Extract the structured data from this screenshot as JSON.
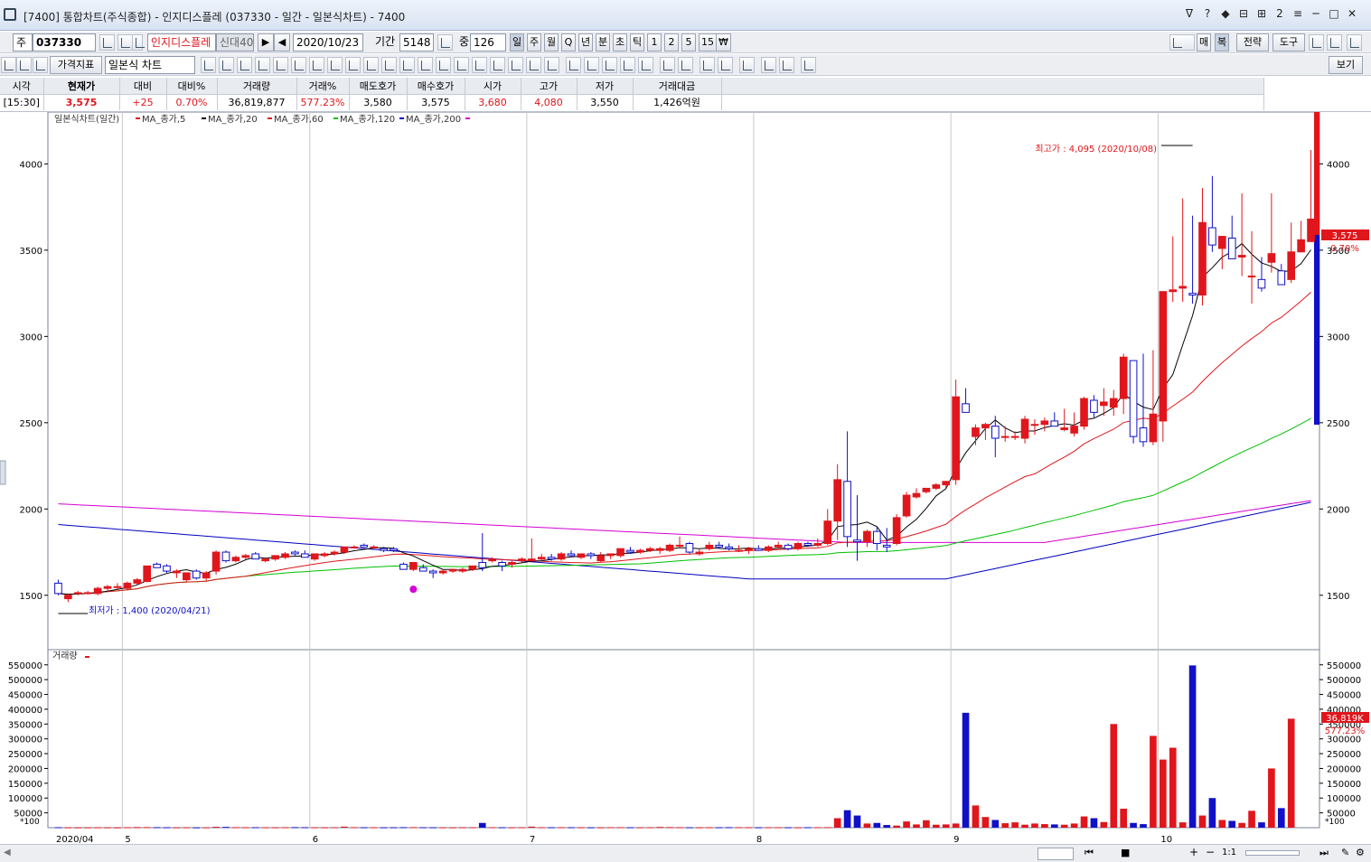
{
  "window": {
    "title": "[7400]  통합차트(주식종합)  - 인지디스플레 (037330 - 일간 - 일본식차트)  - 7400",
    "controls": [
      "ᐁ",
      "?",
      "◆",
      "⊟",
      "⊞",
      "2",
      "≡",
      "─",
      "□",
      "✕"
    ]
  },
  "toolbar1": {
    "market": "주",
    "code": "037330",
    "name": "인지디스플레",
    "credit": "신대40",
    "date": "2020/10/23",
    "period_label": "기간",
    "period": "5148",
    "mid_label": "중",
    "count": "126",
    "periods": [
      "일",
      "주",
      "월",
      "Q",
      "년",
      "분",
      "초",
      "틱",
      "1",
      "2",
      "5",
      "15",
      "₩"
    ],
    "right_buttons": [
      "매",
      "복",
      "전략",
      "도구"
    ]
  },
  "toolbar2": {
    "indicator": "가격지표",
    "chart_type": "일본식 차트",
    "view": "보기"
  },
  "quote": {
    "headers": [
      "시각",
      "현재가",
      "대비",
      "대비%",
      "거래량",
      "거래%",
      "매도호가",
      "매수호가",
      "시가",
      "고가",
      "저가",
      "거래대금"
    ],
    "values": [
      "[15:30]",
      "3,575",
      "+25",
      "0.70%",
      "36,819,877",
      "577.23%",
      "3,580",
      "3,575",
      "3,680",
      "4,080",
      "3,550",
      "1,426억원"
    ]
  },
  "chart_data": {
    "type": "candlestick",
    "title": "일본식차트(일간)",
    "legend": [
      "MA_종가,5",
      "MA_종가,20",
      "MA_종가,60",
      "MA_종가,120",
      "MA_종가,200"
    ],
    "ma_colors": [
      "#e0161c",
      "#000000",
      "#e0161c",
      "#00c000",
      "#0000c0",
      "#d400d4"
    ],
    "price_axis": {
      "ticks": [
        1500,
        2000,
        2500,
        3000,
        3500,
        4000
      ],
      "ylim": [
        1190,
        4290
      ]
    },
    "volume_label": "거래량",
    "volume_axis": {
      "ticks": [
        50000,
        100000,
        150000,
        200000,
        250000,
        300000,
        350000,
        400000,
        450000,
        500000,
        550000
      ],
      "ylim": [
        0,
        592000
      ],
      "unit": "*100"
    },
    "x_labels": [
      "2020/04",
      "5",
      "6",
      "7",
      "8",
      "9",
      "10"
    ],
    "x_label_index": [
      0,
      7,
      26,
      48,
      71,
      91,
      112
    ],
    "current_price_tag": "3,575",
    "current_pct_tag": "0.70%",
    "volume_tag": "36,819K",
    "volume_pct_tag": "577.23%",
    "high_note": "최고가 : 4,095 (2020/10/08)",
    "low_note": "최저가 : 1,400 (2020/04/21)",
    "candles": [
      [
        1570,
        1590,
        1500,
        1510
      ],
      [
        1480,
        1510,
        1460,
        1500
      ],
      [
        1510,
        1525,
        1500,
        1515
      ],
      [
        1515,
        1525,
        1505,
        1515
      ],
      [
        1510,
        1550,
        1500,
        1540
      ],
      [
        1540,
        1560,
        1520,
        1550
      ],
      [
        1550,
        1570,
        1530,
        1550
      ],
      [
        1540,
        1580,
        1530,
        1570
      ],
      [
        1570,
        1600,
        1560,
        1590
      ],
      [
        1580,
        1670,
        1575,
        1670
      ],
      [
        1680,
        1690,
        1660,
        1660
      ],
      [
        1670,
        1680,
        1630,
        1640
      ],
      [
        1630,
        1650,
        1600,
        1640
      ],
      [
        1590,
        1630,
        1580,
        1630
      ],
      [
        1640,
        1650,
        1590,
        1600
      ],
      [
        1600,
        1640,
        1580,
        1630
      ],
      [
        1640,
        1760,
        1620,
        1750
      ],
      [
        1750,
        1760,
        1690,
        1700
      ],
      [
        1700,
        1730,
        1690,
        1720
      ],
      [
        1720,
        1740,
        1710,
        1730
      ],
      [
        1740,
        1750,
        1710,
        1710
      ],
      [
        1700,
        1720,
        1690,
        1710
      ],
      [
        1710,
        1730,
        1700,
        1730
      ],
      [
        1720,
        1750,
        1710,
        1740
      ],
      [
        1750,
        1760,
        1730,
        1740
      ],
      [
        1740,
        1760,
        1720,
        1720
      ],
      [
        1710,
        1730,
        1700,
        1740
      ],
      [
        1730,
        1750,
        1720,
        1740
      ],
      [
        1740,
        1760,
        1730,
        1750
      ],
      [
        1750,
        1780,
        1740,
        1780
      ],
      [
        1780,
        1790,
        1770,
        1780
      ],
      [
        1790,
        1800,
        1780,
        1780
      ],
      [
        1780,
        1790,
        1770,
        1780
      ],
      [
        1770,
        1780,
        1750,
        1760
      ],
      [
        1770,
        1780,
        1750,
        1760
      ],
      [
        1680,
        1690,
        1650,
        1650
      ],
      [
        1650,
        1690,
        1640,
        1690
      ],
      [
        1660,
        1680,
        1640,
        1640
      ],
      [
        1640,
        1650,
        1600,
        1630
      ],
      [
        1630,
        1650,
        1620,
        1640
      ],
      [
        1640,
        1650,
        1630,
        1650
      ],
      [
        1640,
        1660,
        1630,
        1650
      ],
      [
        1650,
        1670,
        1640,
        1670
      ],
      [
        1690,
        1860,
        1640,
        1660
      ],
      [
        1700,
        1720,
        1690,
        1710
      ],
      [
        1690,
        1700,
        1640,
        1670
      ],
      [
        1680,
        1700,
        1660,
        1690
      ],
      [
        1700,
        1720,
        1690,
        1710
      ],
      [
        1700,
        1830,
        1700,
        1710
      ],
      [
        1710,
        1740,
        1700,
        1720
      ],
      [
        1720,
        1740,
        1700,
        1710
      ],
      [
        1710,
        1750,
        1700,
        1740
      ],
      [
        1740,
        1760,
        1720,
        1730
      ],
      [
        1720,
        1740,
        1710,
        1740
      ],
      [
        1740,
        1750,
        1710,
        1730
      ],
      [
        1700,
        1750,
        1690,
        1730
      ],
      [
        1730,
        1740,
        1710,
        1740
      ],
      [
        1730,
        1770,
        1720,
        1770
      ],
      [
        1760,
        1780,
        1740,
        1750
      ],
      [
        1750,
        1770,
        1740,
        1760
      ],
      [
        1760,
        1780,
        1750,
        1770
      ],
      [
        1760,
        1780,
        1740,
        1770
      ],
      [
        1760,
        1800,
        1750,
        1790
      ],
      [
        1790,
        1840,
        1770,
        1790
      ],
      [
        1800,
        1810,
        1740,
        1750
      ],
      [
        1740,
        1770,
        1730,
        1750
      ],
      [
        1770,
        1810,
        1760,
        1790
      ],
      [
        1790,
        1810,
        1770,
        1780
      ],
      [
        1780,
        1800,
        1760,
        1770
      ],
      [
        1760,
        1790,
        1750,
        1760
      ],
      [
        1760,
        1780,
        1740,
        1770
      ],
      [
        1770,
        1790,
        1760,
        1760
      ],
      [
        1760,
        1790,
        1750,
        1780
      ],
      [
        1780,
        1810,
        1770,
        1790
      ],
      [
        1790,
        1800,
        1760,
        1770
      ],
      [
        1770,
        1810,
        1760,
        1800
      ],
      [
        1800,
        1810,
        1780,
        1790
      ],
      [
        1790,
        1830,
        1780,
        1800
      ],
      [
        1800,
        2000,
        1790,
        1930
      ],
      [
        1930,
        2260,
        1820,
        2170
      ],
      [
        2160,
        2450,
        1780,
        1840
      ],
      [
        1820,
        2080,
        1700,
        1810
      ],
      [
        1810,
        1880,
        1780,
        1870
      ],
      [
        1870,
        1900,
        1760,
        1800
      ],
      [
        1790,
        1890,
        1750,
        1780
      ],
      [
        1800,
        1970,
        1790,
        1950
      ],
      [
        1960,
        2100,
        1950,
        2080
      ],
      [
        2070,
        2120,
        2060,
        2090
      ],
      [
        2100,
        2120,
        2090,
        2120
      ],
      [
        2120,
        2150,
        2110,
        2140
      ],
      [
        2140,
        2160,
        2120,
        2160
      ],
      [
        2170,
        2750,
        2140,
        2650
      ],
      [
        2610,
        2700,
        2580,
        2560
      ],
      [
        2420,
        2490,
        2370,
        2470
      ],
      [
        2470,
        2500,
        2400,
        2490
      ],
      [
        2480,
        2540,
        2300,
        2410
      ],
      [
        2420,
        2480,
        2390,
        2420
      ],
      [
        2420,
        2450,
        2400,
        2420
      ],
      [
        2410,
        2540,
        2380,
        2520
      ],
      [
        2490,
        2520,
        2430,
        2490
      ],
      [
        2490,
        2530,
        2450,
        2510
      ],
      [
        2510,
        2560,
        2490,
        2480
      ],
      [
        2460,
        2580,
        2450,
        2470
      ],
      [
        2440,
        2560,
        2420,
        2480
      ],
      [
        2480,
        2650,
        2460,
        2640
      ],
      [
        2630,
        2660,
        2530,
        2560
      ],
      [
        2600,
        2700,
        2540,
        2620
      ],
      [
        2590,
        2690,
        2540,
        2640
      ],
      [
        2640,
        2900,
        2550,
        2880
      ],
      [
        2860,
        2860,
        2380,
        2420
      ],
      [
        2470,
        2900,
        2360,
        2390
      ],
      [
        2390,
        2920,
        2370,
        2550
      ],
      [
        2510,
        2940,
        2390,
        3260
      ],
      [
        3260,
        3580,
        3200,
        3270
      ],
      [
        3280,
        3800,
        3200,
        3290
      ],
      [
        3250,
        3700,
        3190,
        3240
      ],
      [
        3240,
        3860,
        3180,
        3660
      ],
      [
        3630,
        3930,
        3490,
        3530
      ],
      [
        3510,
        3580,
        3390,
        3580
      ],
      [
        3570,
        3700,
        3490,
        3450
      ],
      [
        3460,
        3830,
        3350,
        3470
      ],
      [
        3350,
        3610,
        3190,
        3350
      ],
      [
        3330,
        3460,
        3260,
        3280
      ],
      [
        3430,
        3830,
        3370,
        3480
      ],
      [
        3380,
        3420,
        3320,
        3300
      ],
      [
        3330,
        3660,
        3310,
        3490
      ],
      [
        3490,
        3670,
        3500,
        3560
      ],
      [
        3550,
        4080,
        3550,
        3680
      ]
    ],
    "volume": [
      1500,
      1200,
      1000,
      1100,
      1300,
      1200,
      900,
      1500,
      2000,
      1800,
      1600,
      1400,
      1200,
      1300,
      1100,
      1200,
      3000,
      2500,
      1700,
      1600,
      1500,
      1400,
      1300,
      1500,
      1800,
      1600,
      1400,
      1300,
      1500,
      3500,
      1600,
      1400,
      1500,
      1300,
      1400,
      1600,
      1700,
      1500,
      1400,
      1300,
      1200,
      1400,
      1600,
      16000,
      1500,
      1400,
      1300,
      1500,
      3500,
      1500,
      1400,
      1600,
      1500,
      1400,
      1300,
      1200,
      1500,
      1600,
      1400,
      1300,
      1500,
      2400,
      1900,
      1500,
      1400,
      1300,
      1500,
      1400,
      1600,
      1500,
      1400,
      1300,
      1500,
      1500,
      1400,
      1300,
      1500,
      1600,
      1700,
      32000,
      59000,
      41000,
      14000,
      16000,
      9000,
      7000,
      21000,
      11000,
      25000,
      10000,
      11000,
      14000,
      388000,
      75000,
      36000,
      26000,
      15000,
      18000,
      10000,
      14000,
      12000,
      11000,
      10000,
      14000,
      38000,
      32000,
      19000,
      350000,
      64000,
      16000,
      12000,
      310000,
      230000,
      270000,
      18000,
      548000,
      41000,
      100000,
      26000,
      23000,
      16000,
      57000,
      18000,
      200000,
      66000,
      368000
    ]
  },
  "bottom": {
    "zoom": "1:1"
  }
}
